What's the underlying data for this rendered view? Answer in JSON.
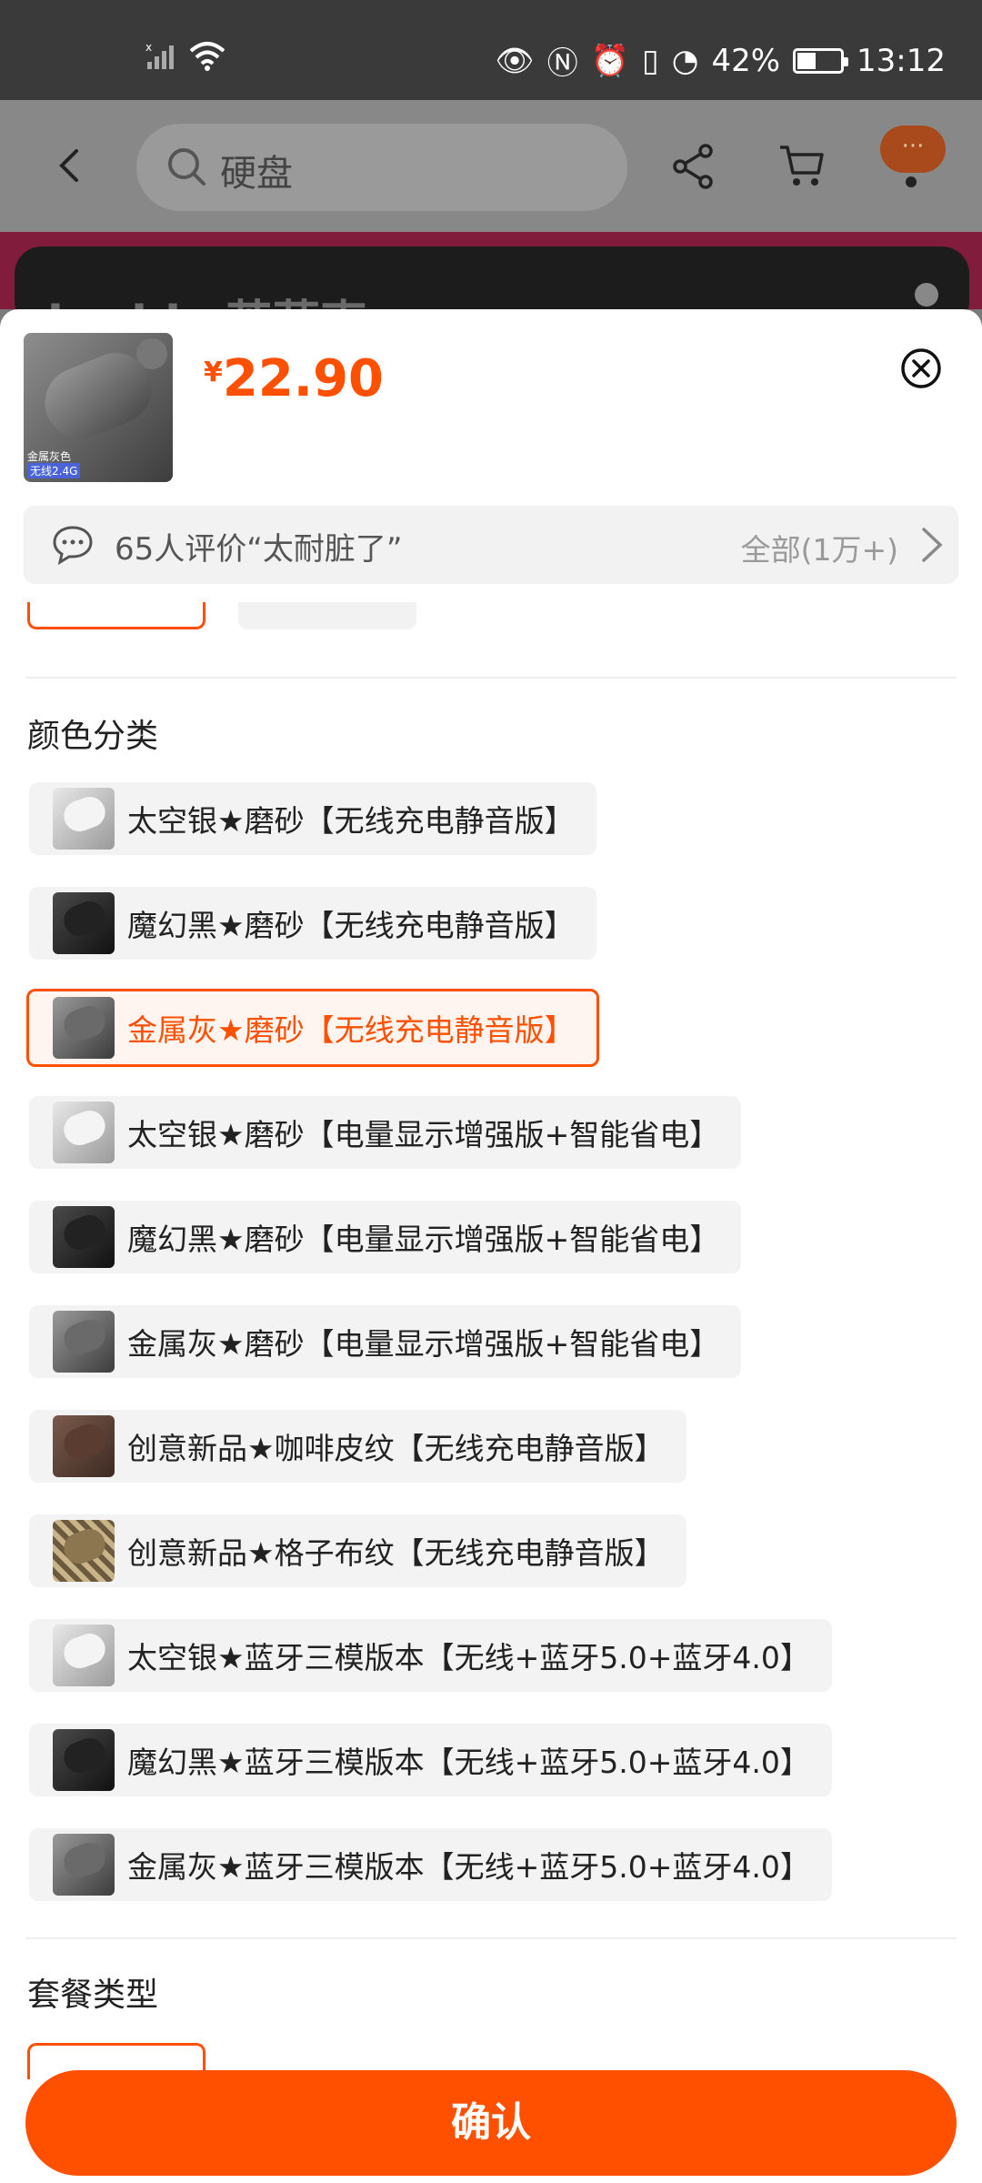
{
  "status": {
    "battery": "42%",
    "time": "13:12"
  },
  "header": {
    "search_text": "硬盘",
    "more_label": "···"
  },
  "banner": {
    "logo_text": "inphic 英菲克"
  },
  "product": {
    "currency": "¥",
    "price": "22.90",
    "thumb_tag1": "金属灰色",
    "thumb_tag2": "无线2.4G"
  },
  "review": {
    "text": "65人评价“太耐脏了”",
    "all_label": "全部(1万+)"
  },
  "color_section": {
    "title": "颜色分类",
    "options": [
      {
        "label": "太空银★磨砂【无线充电静音版】",
        "selected": false,
        "icon": "silver"
      },
      {
        "label": "魔幻黑★磨砂【无线充电静音版】",
        "selected": false,
        "icon": "black"
      },
      {
        "label": "金属灰★磨砂【无线充电静音版】",
        "selected": true,
        "icon": "gray"
      },
      {
        "label": "太空银★磨砂【电量显示增强版+智能省电】",
        "selected": false,
        "icon": "silver"
      },
      {
        "label": "魔幻黑★磨砂【电量显示增强版+智能省电】",
        "selected": false,
        "icon": "black"
      },
      {
        "label": "金属灰★磨砂【电量显示增强版+智能省电】",
        "selected": false,
        "icon": "gray"
      },
      {
        "label": "创意新品★咖啡皮纹【无线充电静音版】",
        "selected": false,
        "icon": "coffee"
      },
      {
        "label": "创意新品★格子布纹【无线充电静音版】",
        "selected": false,
        "icon": "plaid"
      },
      {
        "label": "太空银★蓝牙三模版本【无线+蓝牙5.0+蓝牙4.0】",
        "selected": false,
        "icon": "silver"
      },
      {
        "label": "魔幻黑★蓝牙三模版本【无线+蓝牙5.0+蓝牙4.0】",
        "selected": false,
        "icon": "black"
      },
      {
        "label": "金属灰★蓝牙三模版本【无线+蓝牙5.0+蓝牙4.0】",
        "selected": false,
        "icon": "gray"
      }
    ]
  },
  "package_section": {
    "title": "套餐类型"
  },
  "confirm_label": "确认",
  "colors": {
    "accent": "#ff5000"
  }
}
